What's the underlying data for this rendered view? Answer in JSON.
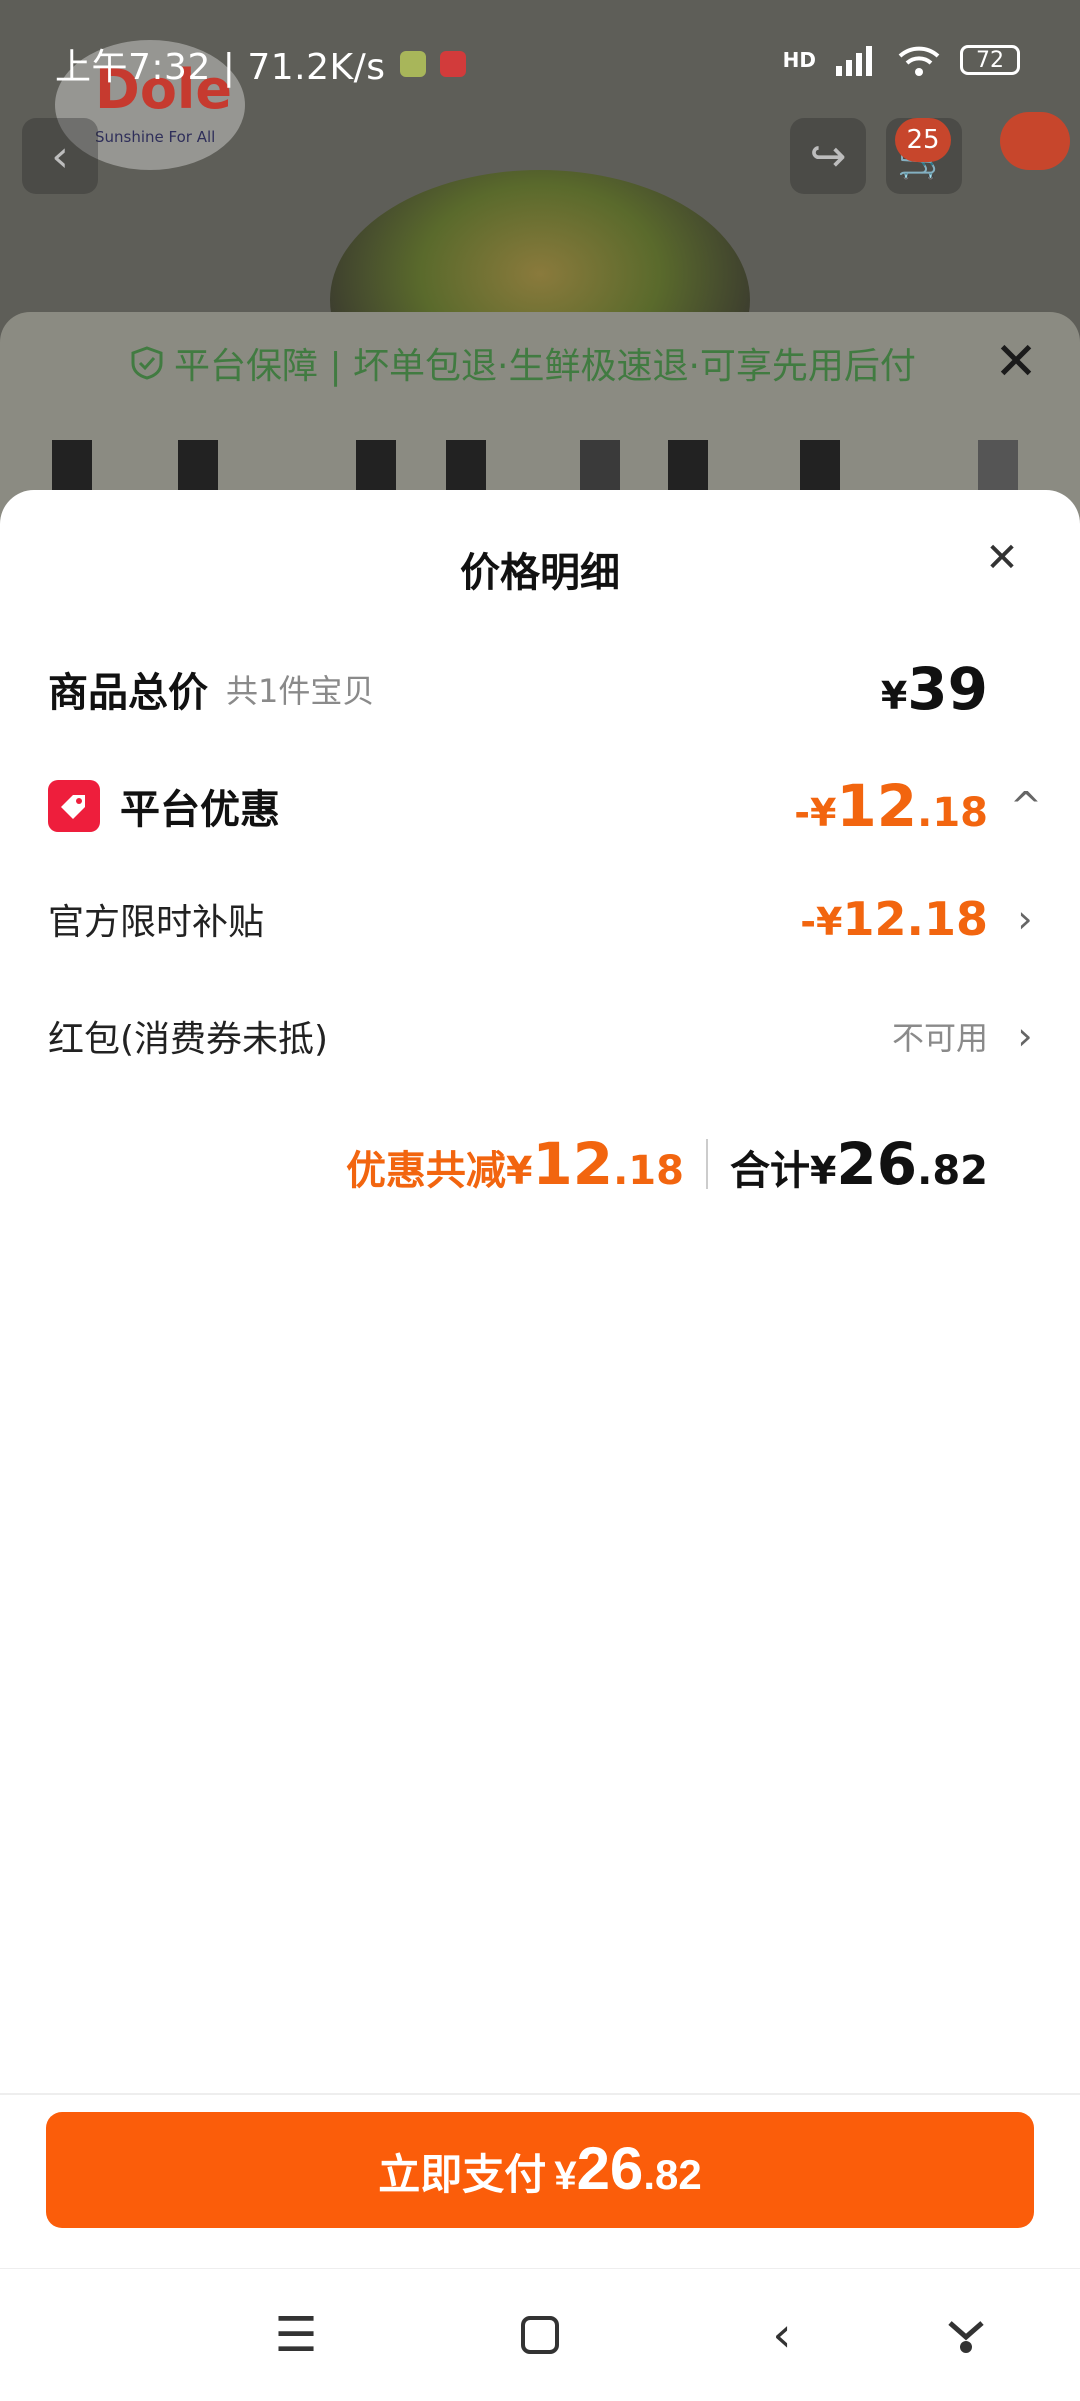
{
  "status_bar": {
    "time_speed": "上午7:32 | 71.2K/s",
    "network": "HD",
    "battery": "72"
  },
  "background": {
    "logo_text": "Dole",
    "logo_sub": "Sunshine For All",
    "cart_badge": "25"
  },
  "guarantee": {
    "text": "平台保障 | 坏单包退·生鲜极速退·可享先用后付"
  },
  "sheet": {
    "title": "价格明细",
    "rows": {
      "total": {
        "label": "商品总价",
        "sub": "共1件宝贝",
        "yen": "¥",
        "amount": "39"
      },
      "platform": {
        "label": "平台优惠",
        "prefix": "-",
        "yen": "¥",
        "int": "12",
        "dec": ".18"
      },
      "subsidy": {
        "label": "官方限时补贴",
        "prefix": "-",
        "yen": "¥",
        "int": "12",
        "dec": ".18"
      },
      "redpacket": {
        "label": "红包(消费券未抵)",
        "value": "不可用"
      }
    },
    "summary": {
      "discount_label": "优惠共减",
      "discount_yen": "¥",
      "discount_int": "12",
      "discount_dec": ".18",
      "total_label": "合计",
      "total_yen": "¥",
      "total_int": "26",
      "total_dec": ".82"
    }
  },
  "pay_button": {
    "label": "立即支付",
    "yen": "¥",
    "int": "26",
    "dec": ".82"
  },
  "colors": {
    "accent": "#f2650f",
    "button": "#fb5d0a",
    "tag": "#ee1e3c"
  }
}
